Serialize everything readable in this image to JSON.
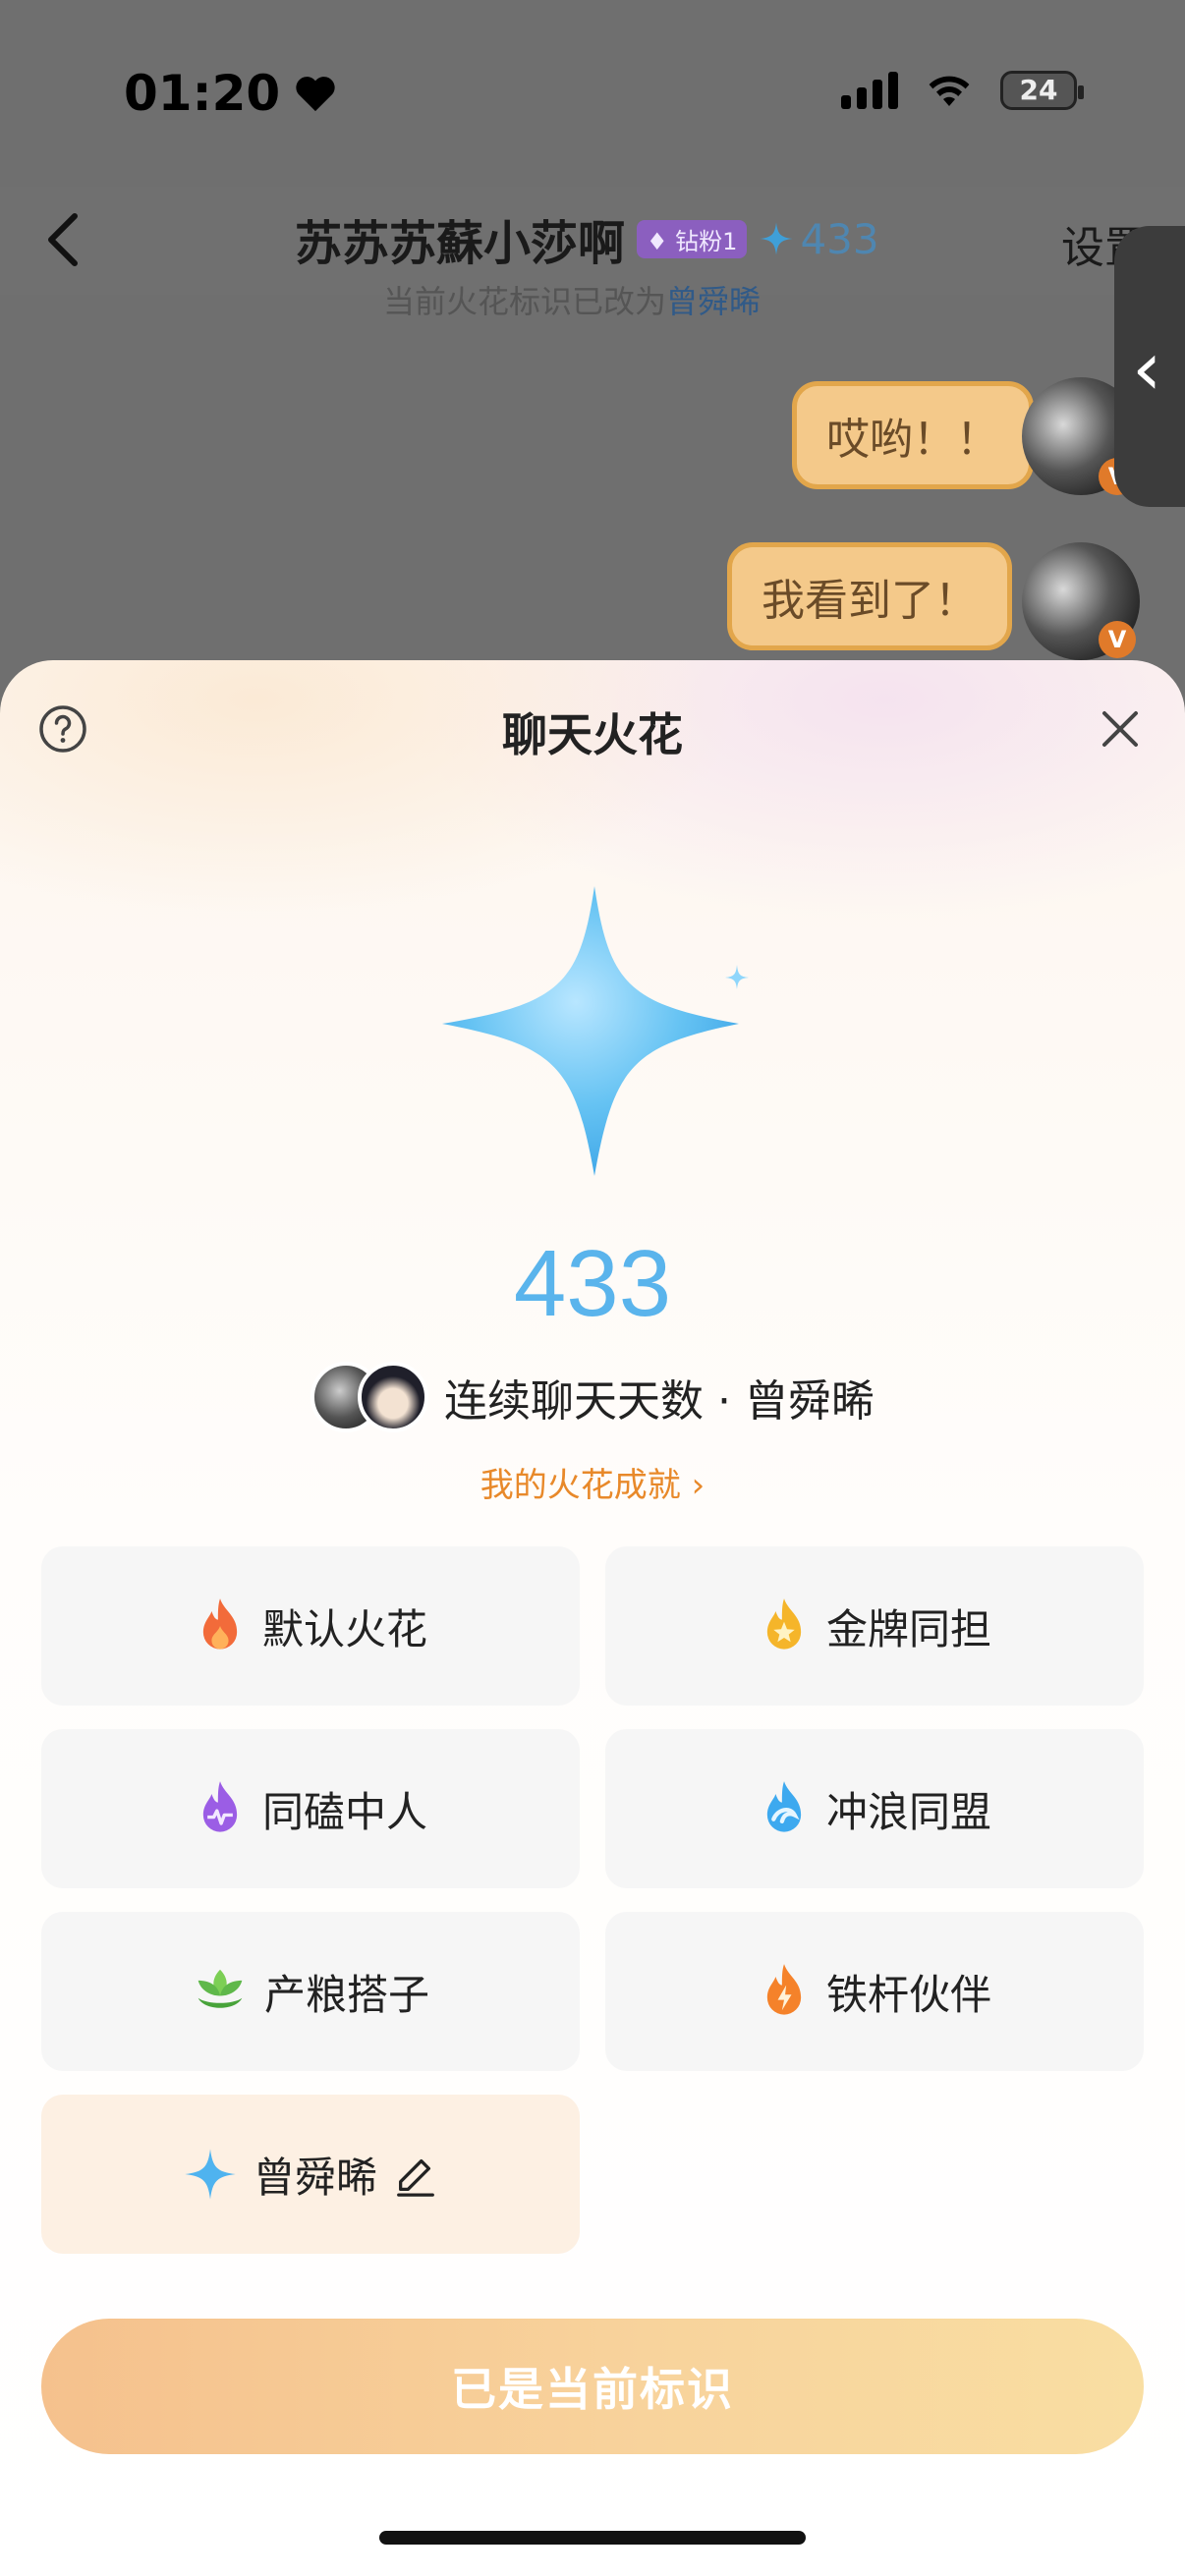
{
  "status_bar": {
    "time": "01:20",
    "battery": "24"
  },
  "chat": {
    "title": "苏苏苏蘇小莎啊",
    "fan_badge": "钻粉1",
    "spark_count": "433",
    "settings_label": "设置",
    "notice_prefix": "当前火花标识已改为",
    "notice_name": "曾舜晞",
    "messages": [
      "哎哟！！",
      "我看到了！"
    ]
  },
  "sheet": {
    "title": "聊天火花",
    "count": "433",
    "days_label": "连续聊天天数 · 曾舜晞",
    "achievement_link": "我的火花成就",
    "options": [
      {
        "label": "默认火花",
        "icon": "flame-orange-icon"
      },
      {
        "label": "金牌同担",
        "icon": "gold-star-flame-icon"
      },
      {
        "label": "同磕中人",
        "icon": "purple-heartbeat-flame-icon"
      },
      {
        "label": "冲浪同盟",
        "icon": "blue-wave-flame-icon"
      },
      {
        "label": "产粮搭子",
        "icon": "green-leaf-icon"
      },
      {
        "label": "铁杆伙伴",
        "icon": "lightning-flame-icon"
      },
      {
        "label": "曾舜晞",
        "icon": "blue-sparkle-icon",
        "selected": true
      }
    ],
    "cta_label": "已是当前标识"
  },
  "colors": {
    "accent_orange": "#e8892a",
    "spark_blue": "#5ab4ec",
    "cta_start": "#f5c18d",
    "cta_end": "#f9dea2",
    "selected_tile": "#fdf0e3"
  }
}
